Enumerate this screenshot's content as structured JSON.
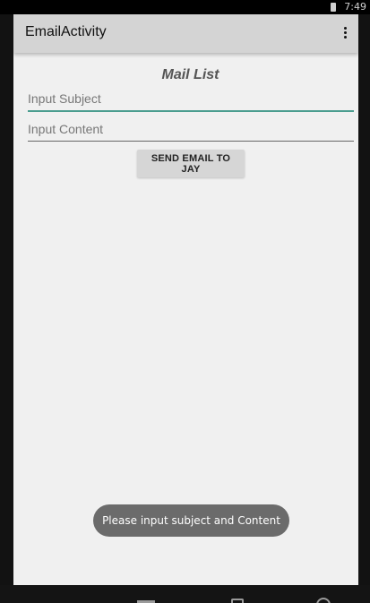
{
  "status_bar": {
    "time": "7:49"
  },
  "toolbar": {
    "title": "EmailActivity"
  },
  "main": {
    "title": "Mail List",
    "subject_placeholder": "Input Subject",
    "subject_value": "",
    "content_placeholder": "Input Content",
    "content_value": "",
    "send_label": "SEND EMAIL TO JAY"
  },
  "toast": {
    "message": "Please input subject and Content"
  },
  "colors": {
    "accent": "#4a9d8f",
    "toolbar": "#d4d4d4",
    "background": "#f0f0f0"
  },
  "icons": [
    "overflow-menu-icon",
    "battery-icon",
    "nav-back-icon",
    "nav-home-icon",
    "nav-recent-icon"
  ]
}
